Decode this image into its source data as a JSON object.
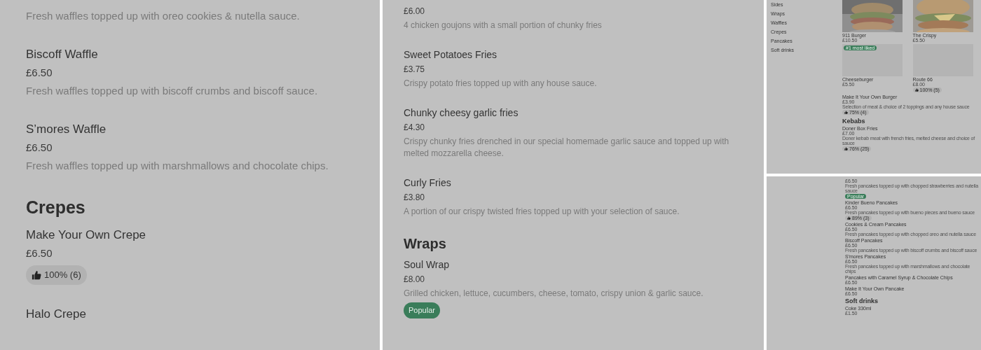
{
  "panels": [
    {
      "kind": "large",
      "blocks": [
        {
          "kind": "item",
          "description": "Fresh waffles topped up with oreo cookies & nutella sauce."
        },
        {
          "kind": "item",
          "name": "Biscoff Waffle",
          "price": "£6.50",
          "description": "Fresh waffles topped up with biscoff crumbs and biscoff sauce."
        },
        {
          "kind": "item",
          "name": "S’mores Waffle",
          "price": "£6.50",
          "description": "Fresh waffles topped up with marshmallows and chocolate chips."
        },
        {
          "kind": "heading",
          "text": "Crepes"
        },
        {
          "kind": "item",
          "name": "Make Your Own Crepe",
          "price": "£6.50",
          "rating": "100% (6)"
        },
        {
          "kind": "item",
          "name": "Halo Crepe"
        }
      ]
    },
    {
      "kind": "medium",
      "blocks": [
        {
          "kind": "item",
          "price": "£6.00",
          "description": "4 chicken goujons with a small portion of chunky fries"
        },
        {
          "kind": "item",
          "name": "Sweet Potatoes Fries",
          "price": "£3.75",
          "description": "Crispy potato fries topped up with any house sauce."
        },
        {
          "kind": "item",
          "name": "Chunky cheesy garlic fries",
          "price": "£4.30",
          "description": "Crispy chunky fries drenched in our special homemade garlic sauce and topped up with melted mozzarella cheese."
        },
        {
          "kind": "item",
          "name": "Curly Fries",
          "price": "£3.80",
          "description": "A portion of our crispy twisted fries topped up with your selection of sauce."
        },
        {
          "kind": "heading",
          "text": "Wraps"
        },
        {
          "kind": "item",
          "name": "Soul Wrap",
          "price": "£8.00",
          "description": "Grilled chicken, lettuce, cucumbers, cheese, tomato, crispy union & garlic sauce.",
          "badge": "Popular"
        }
      ]
    },
    {
      "kind": "small",
      "sidebar": [
        "Sides",
        "Wraps",
        "Waffles",
        "Crepes",
        "Pancakes",
        "Soft drinks"
      ],
      "cards": [
        {
          "name": "911 Burger",
          "price": "£10.50",
          "kind": "picture"
        },
        {
          "name": "The Crispy",
          "price": "£5.50",
          "kind": "picture"
        },
        {
          "name": "Cheeseburger",
          "price": "£5.50",
          "badge": "#1 most liked"
        },
        {
          "name": "Route 66",
          "price": "£8.00",
          "rating": "100% (5)"
        }
      ],
      "blocks": [
        {
          "kind": "item",
          "name": "Make It Your Own Burger",
          "price": "£3.90",
          "description": "Selection of meat & choice of 2 toppings and any house sauce",
          "rating": "75% (4)"
        },
        {
          "kind": "heading",
          "text": "Kebabs"
        },
        {
          "kind": "item",
          "name": "Doner Box Fries",
          "price": "£7.00",
          "description": "Doner kebab meat with french fries, melted cheese and choice of sauce",
          "rating": "76% (25)"
        }
      ]
    },
    {
      "kind": "small",
      "blocks": [
        {
          "kind": "item",
          "price": "£6.50",
          "description": "Fresh pancakes topped up with chopped strawberries and nutella sauce",
          "badge": "Popular"
        },
        {
          "kind": "item",
          "name": "Kinder Bueno Pancakes",
          "price": "£6.50",
          "description": "Fresh pancakes topped up with bueno pieces and bueno sauce",
          "rating": "89% (3)"
        },
        {
          "kind": "item",
          "name": "Cookies & Cream Pancakes",
          "price": "£6.50",
          "description": "Fresh pancakes topped up with chopped oreo and nutella sauce"
        },
        {
          "kind": "item",
          "name": "Biscoff Pancakes",
          "price": "£6.50",
          "description": "Fresh pancakes topped up with biscoff crumbs and biscoff sauce"
        },
        {
          "kind": "item",
          "name": "S'mores Pancakes",
          "price": "£6.50",
          "description": "Fresh pancakes topped up with marshmallows and chocolate chips"
        },
        {
          "kind": "item",
          "name": "Pancakes with Caramel Syrup & Chocolate Chips",
          "price": "£6.50"
        },
        {
          "kind": "item",
          "name": "Make It Your Own Pancake",
          "price": "£6.50"
        },
        {
          "kind": "heading",
          "text": "Soft drinks"
        },
        {
          "kind": "item",
          "name": "Coke 330ml",
          "price": "£1.50"
        }
      ]
    }
  ]
}
